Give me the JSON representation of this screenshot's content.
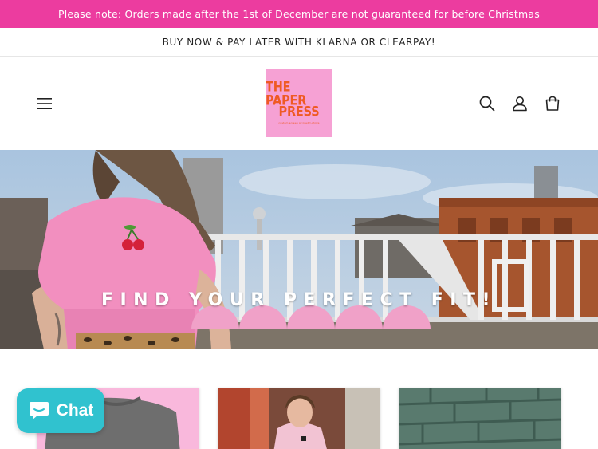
{
  "announcements": {
    "primary": "Please note: Orders made after the 1st of December are not guaranteed for before Christmas",
    "secondary": "BUY NOW & PAY LATER WITH KLARNA OR CLEARPAY!"
  },
  "header": {
    "logo_line1": "THE PAPER",
    "logo_line2": "PRESS",
    "logo_tagline": "custom screen printed t-shirts",
    "icons": [
      "hamburger-menu-icon",
      "search-icon",
      "account-icon",
      "cart-icon"
    ]
  },
  "hero": {
    "heading": "FIND YOUR PERFECT FIT!"
  },
  "collections": {
    "cards": [
      {
        "name": "grey-tshirt-collection"
      },
      {
        "name": "pink-hoodie-collection"
      },
      {
        "name": "tiles-collection"
      }
    ]
  },
  "chat": {
    "label": "Chat"
  },
  "colors": {
    "announcement_bg": "#ec3c9f",
    "logo_bg": "#f6a1d4",
    "logo_text": "#ef5a24",
    "chat_bg": "#30c2cf"
  }
}
